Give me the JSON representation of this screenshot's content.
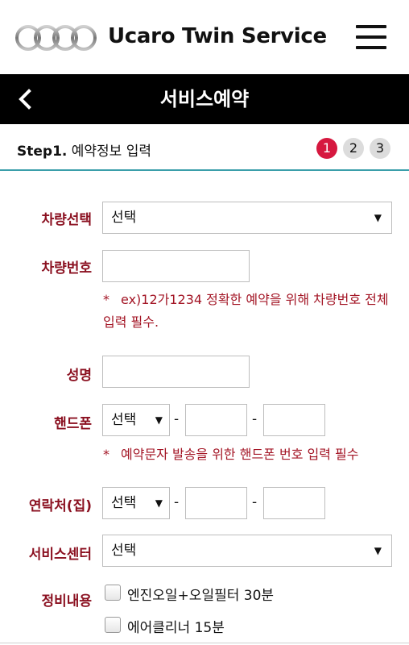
{
  "header": {
    "brand": "Ucaro Twin Service",
    "logo_icon": "four-rings-logo",
    "menu_icon": "hamburger-menu-icon"
  },
  "titlebar": {
    "back_icon": "chevron-left-icon",
    "title": "서비스예약"
  },
  "step": {
    "prefix": "Step1.",
    "title": " 예약정보 입력",
    "indicators": [
      "1",
      "2",
      "3"
    ],
    "active_index": 0,
    "active_color": "#d6183f"
  },
  "form": {
    "vehicle": {
      "label": "차량선택",
      "value": "선택"
    },
    "plate": {
      "label": "차량번호",
      "value": "",
      "note_star": "*",
      "note": "ex)12가1234 정확한 예약을 위해 차량번호 전체 입력 필수."
    },
    "name": {
      "label": "성명",
      "value": ""
    },
    "mobile": {
      "label": "핸드폰",
      "prefix": "선택",
      "dash": "-",
      "mid": "",
      "last": "",
      "note_star": "*",
      "note": "예약문자 발송을 위한 핸드폰 번호 입력 필수"
    },
    "home": {
      "label": "연락처(집)",
      "prefix": "선택",
      "dash": "-",
      "mid": "",
      "last": ""
    },
    "center": {
      "label": "서비스센터",
      "value": "선택"
    },
    "service": {
      "label": "정비내용",
      "options": [
        {
          "label": "엔진오일+오일필터 30분",
          "checked": false
        },
        {
          "label": "에어클리너 15분",
          "checked": false
        }
      ]
    }
  },
  "colors": {
    "label": "#8b1121",
    "note": "#a31525",
    "accent_line": "#3a9eaa",
    "titlebar": "#000000"
  }
}
